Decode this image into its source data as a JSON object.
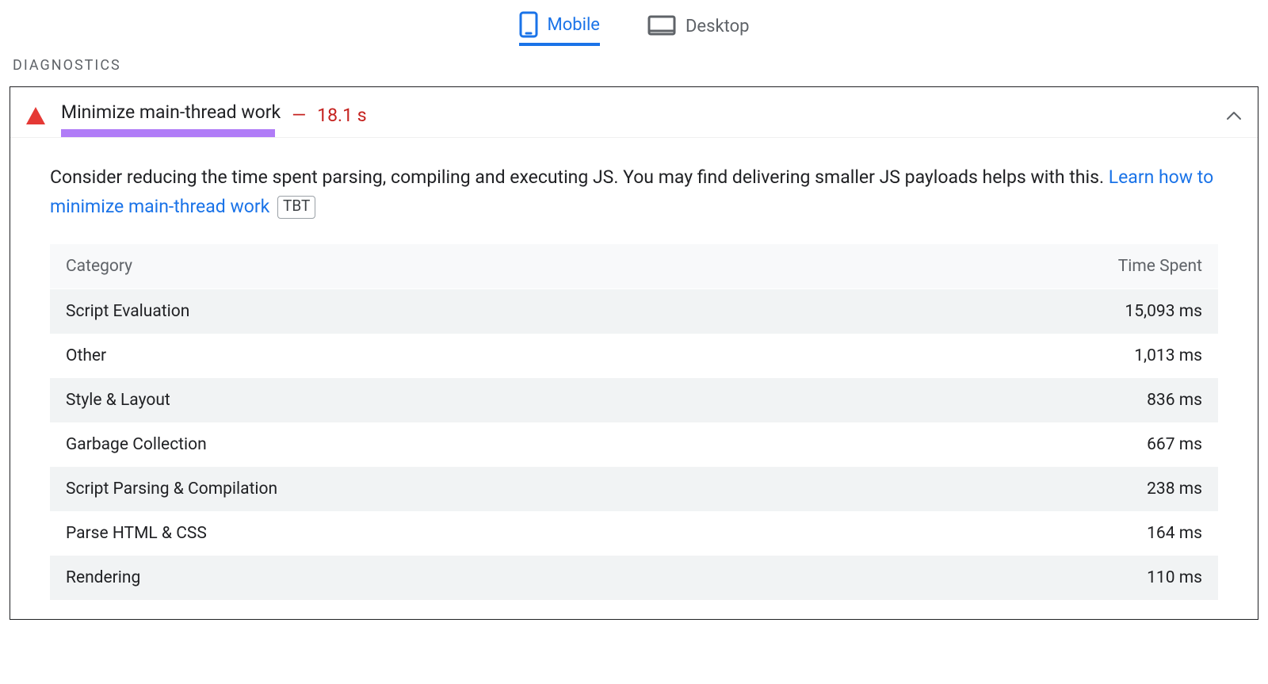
{
  "tabs": {
    "mobile": {
      "label": "Mobile"
    },
    "desktop": {
      "label": "Desktop"
    }
  },
  "section_heading": "DIAGNOSTICS",
  "audit": {
    "title": "Minimize main-thread work",
    "dash": "—",
    "value": "18.1 s",
    "description_pre": "Consider reducing the time spent parsing, compiling and executing JS. You may find delivering smaller JS payloads helps with this. ",
    "link_text": "Learn how to minimize main-thread work",
    "tbt_badge": "TBT"
  },
  "table": {
    "col_category": "Category",
    "col_time": "Time Spent",
    "rows": [
      {
        "category": "Script Evaluation",
        "time": "15,093 ms"
      },
      {
        "category": "Other",
        "time": "1,013 ms"
      },
      {
        "category": "Style & Layout",
        "time": "836 ms"
      },
      {
        "category": "Garbage Collection",
        "time": "667 ms"
      },
      {
        "category": "Script Parsing & Compilation",
        "time": "238 ms"
      },
      {
        "category": "Parse HTML & CSS",
        "time": "164 ms"
      },
      {
        "category": "Rendering",
        "time": "110 ms"
      }
    ]
  },
  "chart_data": {
    "type": "table",
    "title": "Minimize main-thread work — Time Spent by Category",
    "categories": [
      "Script Evaluation",
      "Other",
      "Style & Layout",
      "Garbage Collection",
      "Script Parsing & Compilation",
      "Parse HTML & CSS",
      "Rendering"
    ],
    "values_ms": [
      15093,
      1013,
      836,
      667,
      238,
      164,
      110
    ],
    "total_s": 18.1,
    "xlabel": "Category",
    "ylabel": "Time Spent (ms)"
  }
}
